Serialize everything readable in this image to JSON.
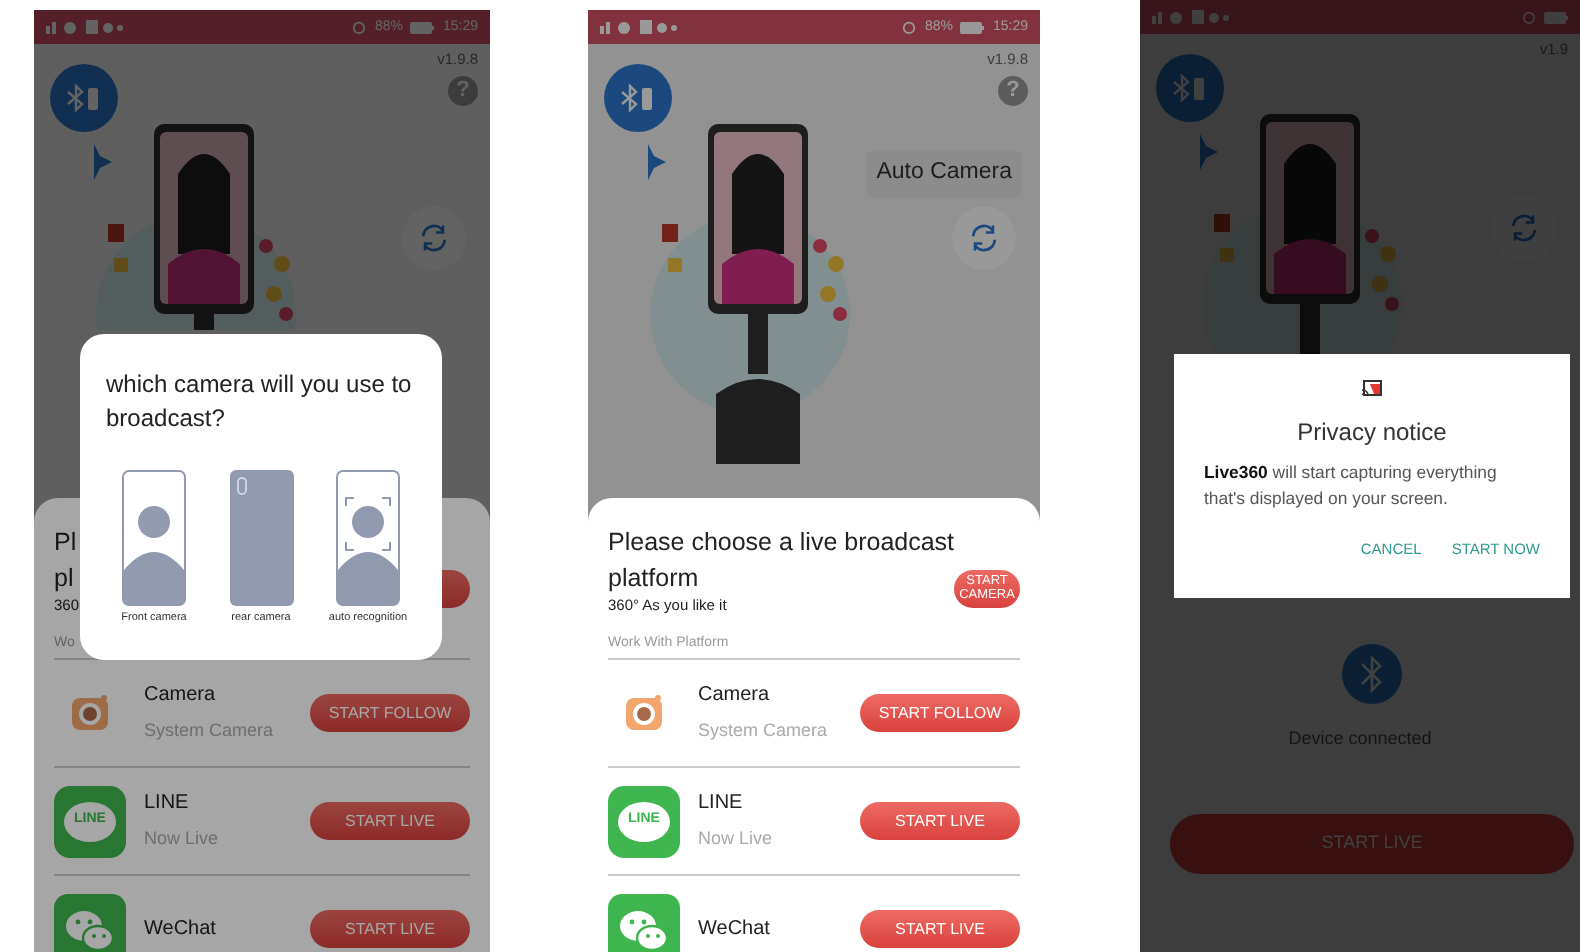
{
  "screens": [
    {
      "status_bar": {
        "battery": "88%",
        "time": "15:29"
      },
      "version": "v1.9.8",
      "help": "?",
      "sheet": {
        "title_lines": [
          "Pl",
          "pl"
        ],
        "subtitle": "360",
        "section_label": "Wo",
        "rows": [
          {
            "kind": "camera",
            "name": "Camera",
            "subtitle": "System Camera",
            "action": "START FOLLOW"
          },
          {
            "kind": "line",
            "icon_text": "LINE",
            "name": "LINE",
            "subtitle": "Now Live",
            "action": "START LIVE"
          },
          {
            "kind": "wechat",
            "name": "WeChat",
            "action": "START LIVE"
          }
        ]
      },
      "dialog": {
        "kind": "camera_choice",
        "title": "which camera will you use to broadcast?",
        "options": [
          {
            "kind": "front",
            "label": "Front camera"
          },
          {
            "kind": "rear",
            "label": "rear camera"
          },
          {
            "kind": "auto",
            "label": "auto recognition"
          }
        ]
      }
    },
    {
      "status_bar": {
        "battery": "88%",
        "time": "15:29"
      },
      "version": "v1.9.8",
      "help": "?",
      "tooltip": "Auto Camera",
      "sheet": {
        "title_lines": [
          "Please choose a live broadcast",
          "platform"
        ],
        "header_button": "START CAMERA",
        "subtitle": "360° As you like it",
        "section_label": "Work With Platform",
        "rows": [
          {
            "kind": "camera",
            "name": "Camera",
            "subtitle": "System Camera",
            "action": "START FOLLOW"
          },
          {
            "kind": "line",
            "icon_text": "LINE",
            "name": "LINE",
            "subtitle": "Now Live",
            "action": "START LIVE"
          },
          {
            "kind": "wechat",
            "name": "WeChat",
            "action": "START LIVE"
          }
        ]
      }
    },
    {
      "version": "v1.9",
      "main": {
        "device_status": "Device connected",
        "button": "START LIVE"
      },
      "dialog": {
        "kind": "privacy",
        "title": "Privacy notice",
        "message": "**Live360** will start capturing everything that's displayed on your screen.",
        "buttons": [
          "CANCEL",
          "START NOW"
        ]
      }
    }
  ]
}
